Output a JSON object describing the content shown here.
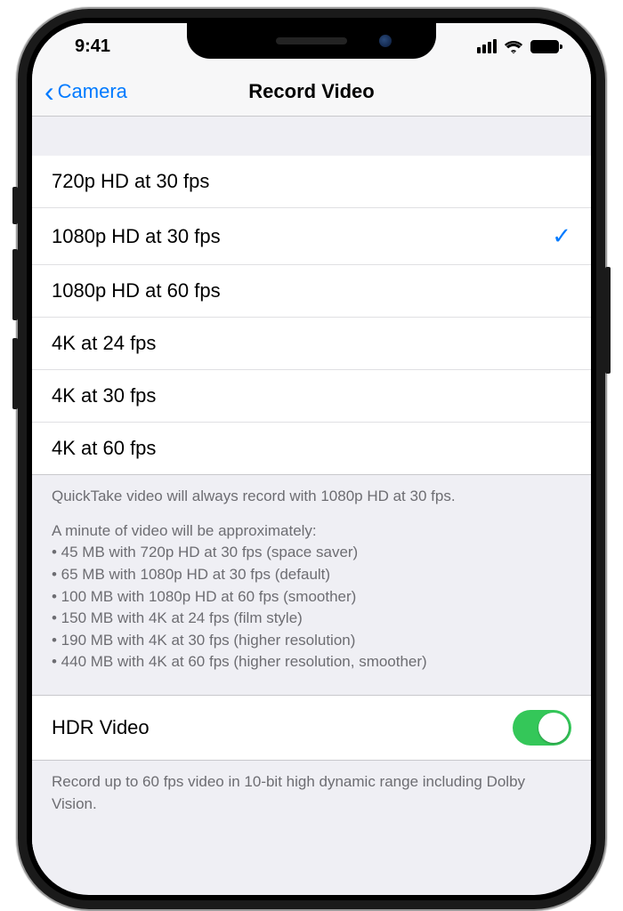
{
  "status": {
    "time": "9:41"
  },
  "nav": {
    "back_label": "Camera",
    "title": "Record Video"
  },
  "options": [
    {
      "label": "720p HD at 30 fps",
      "selected": false
    },
    {
      "label": "1080p HD at 30 fps",
      "selected": true
    },
    {
      "label": "1080p HD at 60 fps",
      "selected": false
    },
    {
      "label": "4K at 24 fps",
      "selected": false
    },
    {
      "label": "4K at 30 fps",
      "selected": false
    },
    {
      "label": "4K at 60 fps",
      "selected": false
    }
  ],
  "footer": {
    "quicktake": "QuickTake video will always record with 1080p HD at 30 fps.",
    "intro": "A minute of video will be approximately:",
    "bullets": [
      "• 45 MB with 720p HD at 30 fps (space saver)",
      "• 65 MB with 1080p HD at 30 fps (default)",
      "• 100 MB with 1080p HD at 60 fps (smoother)",
      "• 150 MB with 4K at 24 fps (film style)",
      "• 190 MB with 4K at 30 fps (higher resolution)",
      "• 440 MB with 4K at 60 fps (higher resolution, smoother)"
    ]
  },
  "hdr": {
    "label": "HDR Video",
    "enabled": true,
    "description": "Record up to 60 fps video in 10-bit high dynamic range including Dolby Vision."
  }
}
